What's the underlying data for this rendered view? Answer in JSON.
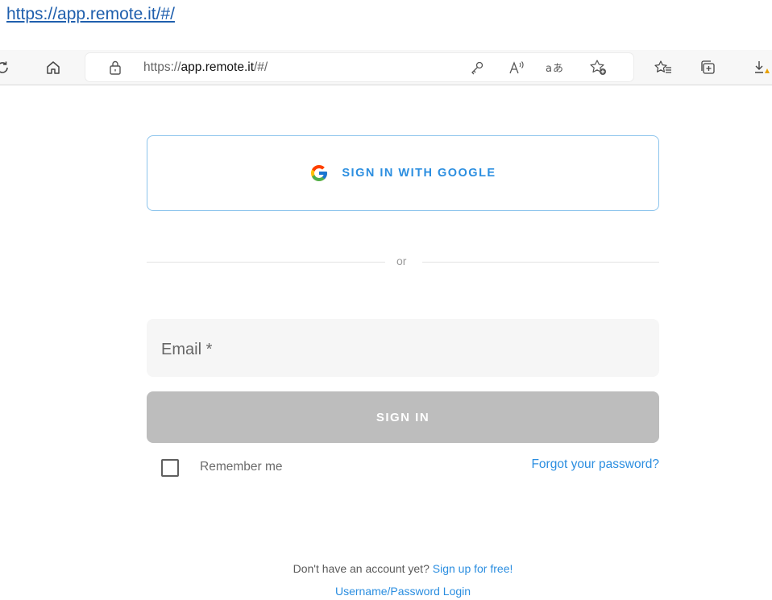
{
  "document_link": {
    "text": "https://app.remote.it/#/"
  },
  "browser": {
    "address": {
      "url_prefix": "https://",
      "url_domain": "app.remote.it",
      "url_rest": "/#/"
    },
    "icons": {
      "refresh": "refresh-icon",
      "home": "home-icon",
      "lock": "lock-icon",
      "key": "key-icon",
      "read_aloud": "read-aloud-icon",
      "translate": "translate-icon",
      "add_favorite": "add-favorite-icon",
      "favorites": "favorites-icon",
      "collections": "collections-icon",
      "downloads": "downloads-icon"
    }
  },
  "login": {
    "google_button_label": "SIGN IN WITH GOOGLE",
    "divider_text": "or",
    "email_label": "Email *",
    "signin_button_label": "SIGN IN",
    "remember_me_label": "Remember me",
    "forgot_password_link": "Forgot your password?",
    "no_account_text": "Don't have an account yet?",
    "signup_link": "Sign up for free!",
    "username_password_link": "Username/Password Login"
  },
  "colors": {
    "accent": "#2b8ee0",
    "google_border": "#8cc4ec",
    "signin_disabled": "#bdbdbd",
    "field_background": "#f6f6f6"
  }
}
